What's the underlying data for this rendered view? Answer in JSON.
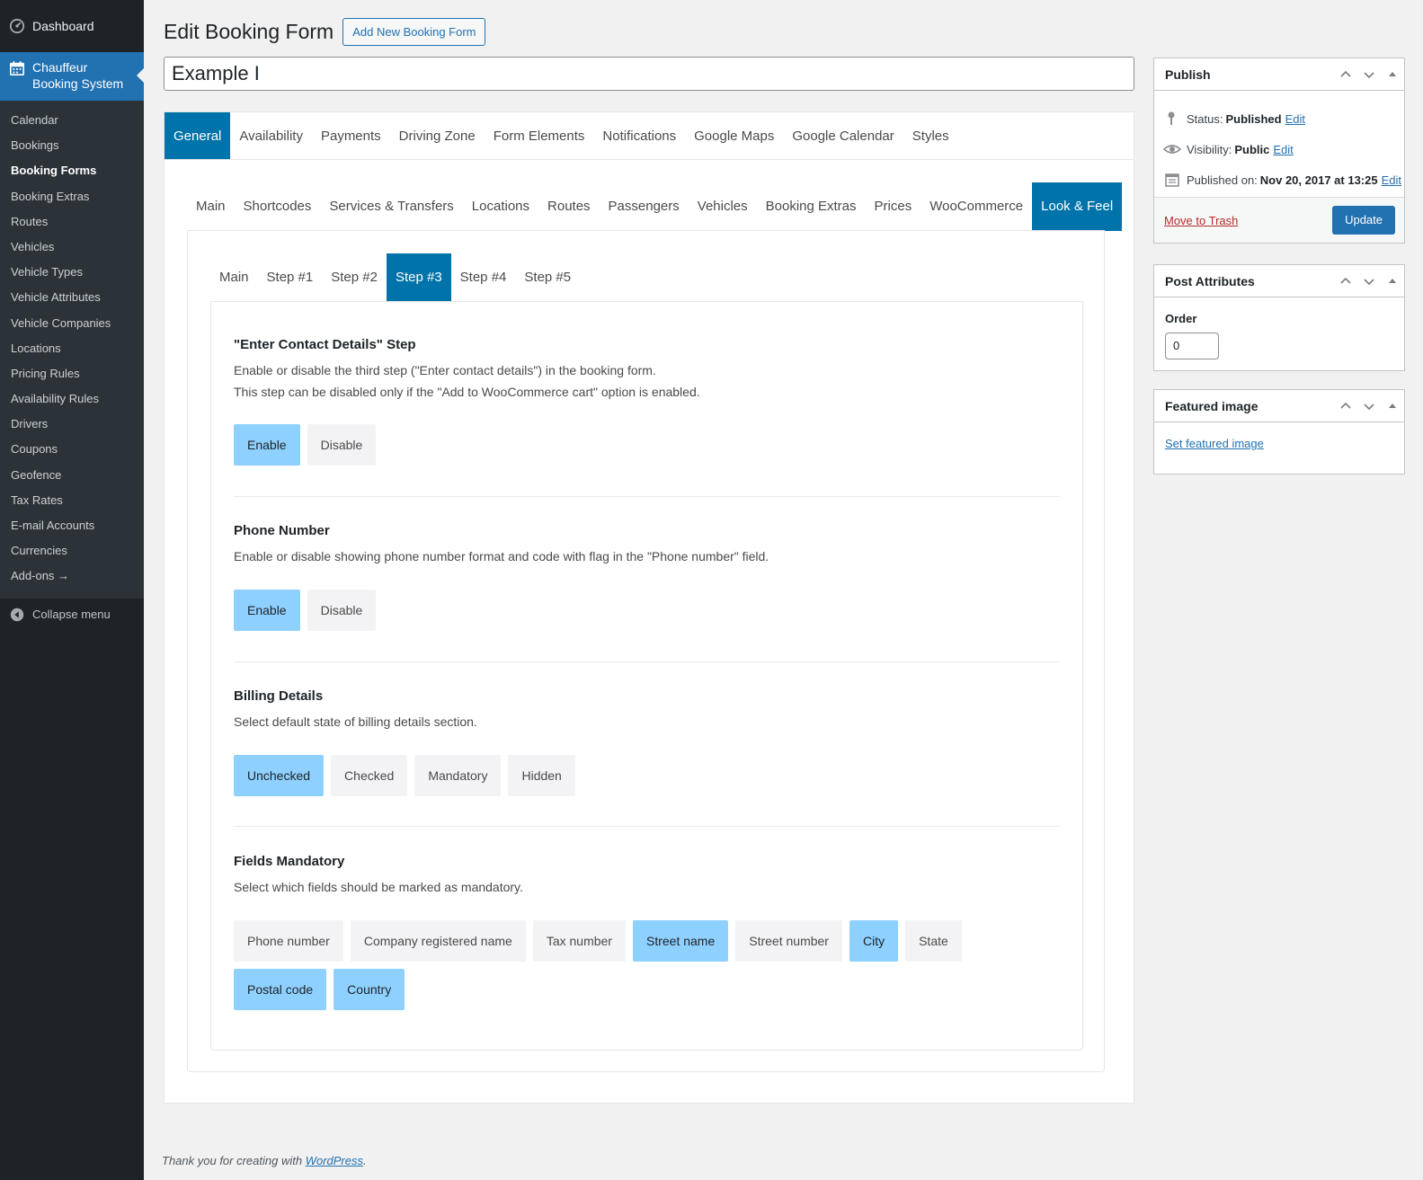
{
  "sidebar": {
    "dashboard": "Dashboard",
    "current_line1": "Chauffeur",
    "current_line2": "Booking System",
    "items": [
      {
        "label": "Calendar"
      },
      {
        "label": "Bookings"
      },
      {
        "label": "Booking Forms",
        "active": true
      },
      {
        "label": "Booking Extras"
      },
      {
        "label": "Routes"
      },
      {
        "label": "Vehicles"
      },
      {
        "label": "Vehicle Types"
      },
      {
        "label": "Vehicle Attributes"
      },
      {
        "label": "Vehicle Companies"
      },
      {
        "label": "Locations"
      },
      {
        "label": "Pricing Rules"
      },
      {
        "label": "Availability Rules"
      },
      {
        "label": "Drivers"
      },
      {
        "label": "Coupons"
      },
      {
        "label": "Geofence"
      },
      {
        "label": "Tax Rates"
      },
      {
        "label": "E-mail Accounts"
      },
      {
        "label": "Currencies"
      },
      {
        "label": "Add-ons →"
      }
    ],
    "collapse": "Collapse menu"
  },
  "header": {
    "title": "Edit Booking Form",
    "add_new": "Add New Booking Form",
    "post_title": "Example I"
  },
  "tabs_main": [
    "General",
    "Availability",
    "Payments",
    "Driving Zone",
    "Form Elements",
    "Notifications",
    "Google Maps",
    "Google Calendar",
    "Styles"
  ],
  "tabs_main_active": 0,
  "tabs_sub": [
    "Main",
    "Shortcodes",
    "Services & Transfers",
    "Locations",
    "Routes",
    "Passengers",
    "Vehicles",
    "Booking Extras",
    "Prices",
    "WooCommerce",
    "Look & Feel"
  ],
  "tabs_sub_active": 10,
  "tabs_step": [
    "Main",
    "Step #1",
    "Step #2",
    "Step #3",
    "Step #4",
    "Step #5"
  ],
  "tabs_step_active": 3,
  "sections": {
    "contact": {
      "title": "\"Enter Contact Details\" Step",
      "desc1": "Enable or disable the third step (\"Enter contact details\") in the booking form.",
      "desc2": "This step can be disabled only if the \"Add to WooCommerce cart\" option is enabled.",
      "options": [
        {
          "label": "Enable",
          "on": true
        },
        {
          "label": "Disable",
          "on": false
        }
      ]
    },
    "phone": {
      "title": "Phone Number",
      "desc1": "Enable or disable showing phone number format and code with flag in the \"Phone number\" field.",
      "options": [
        {
          "label": "Enable",
          "on": true
        },
        {
          "label": "Disable",
          "on": false
        }
      ]
    },
    "billing": {
      "title": "Billing Details",
      "desc1": "Select default state of billing details section.",
      "options": [
        {
          "label": "Unchecked",
          "on": true
        },
        {
          "label": "Checked",
          "on": false
        },
        {
          "label": "Mandatory",
          "on": false
        },
        {
          "label": "Hidden",
          "on": false
        }
      ]
    },
    "fields": {
      "title": "Fields Mandatory",
      "desc1": "Select which fields should be marked as mandatory.",
      "options": [
        {
          "label": "Phone number",
          "on": false
        },
        {
          "label": "Company registered name",
          "on": false
        },
        {
          "label": "Tax number",
          "on": false
        },
        {
          "label": "Street name",
          "on": true
        },
        {
          "label": "Street number",
          "on": false
        },
        {
          "label": "City",
          "on": true
        },
        {
          "label": "State",
          "on": false
        },
        {
          "label": "Postal code",
          "on": true
        },
        {
          "label": "Country",
          "on": true
        }
      ]
    }
  },
  "publish": {
    "title": "Publish",
    "status_label": "Status:",
    "status_value": "Published",
    "visibility_label": "Visibility:",
    "visibility_value": "Public",
    "published_label": "Published on:",
    "published_value": "Nov 20, 2017 at 13:25",
    "edit": "Edit",
    "trash": "Move to Trash",
    "update": "Update"
  },
  "post_attributes": {
    "title": "Post Attributes",
    "order_label": "Order",
    "order_value": "0"
  },
  "featured_image": {
    "title": "Featured image",
    "link": "Set featured image"
  },
  "footer": {
    "text": "Thank you for creating with ",
    "link": "WordPress",
    "end": "."
  },
  "colors": {
    "sidebar_bg": "#1d2327",
    "sidebar_sub_bg": "#2c3338",
    "accent": "#2271b1",
    "tab_active": "#0073aa",
    "option_on": "#8ed0ff",
    "option_off": "#f3f3f5"
  }
}
